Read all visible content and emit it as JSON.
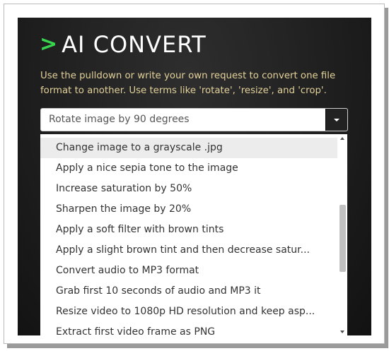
{
  "app": {
    "prompt_symbol": ">",
    "title": "AI CONVERT",
    "description": "Use the pulldown or write your own request to convert one file format to another. Use terms like 'rotate', 'resize', and 'crop'."
  },
  "select": {
    "value": "Rotate image by 90 degrees"
  },
  "dropdown": {
    "options": [
      "Change image to a grayscale .jpg",
      "Apply a nice sepia tone to the image",
      "Increase saturation by 50%",
      "Sharpen the image by 20%",
      "Apply a soft filter with brown tints",
      "Apply a slight brown tint and then decrease satur...",
      "Convert audio to MP3 format",
      "Grab first 10 seconds of audio and MP3 it",
      "Resize video to 1080p HD resolution and keep asp...",
      "Extract first video frame as PNG"
    ],
    "highlighted_index": 0
  },
  "colors": {
    "accent": "#37d64e",
    "description_text": "#e3d19a",
    "panel_background": "#222222"
  },
  "icons": {
    "select_caret": "chevron-down-icon",
    "scroll_up": "scroll-up-arrow-icon",
    "scroll_down": "scroll-down-arrow-icon"
  }
}
